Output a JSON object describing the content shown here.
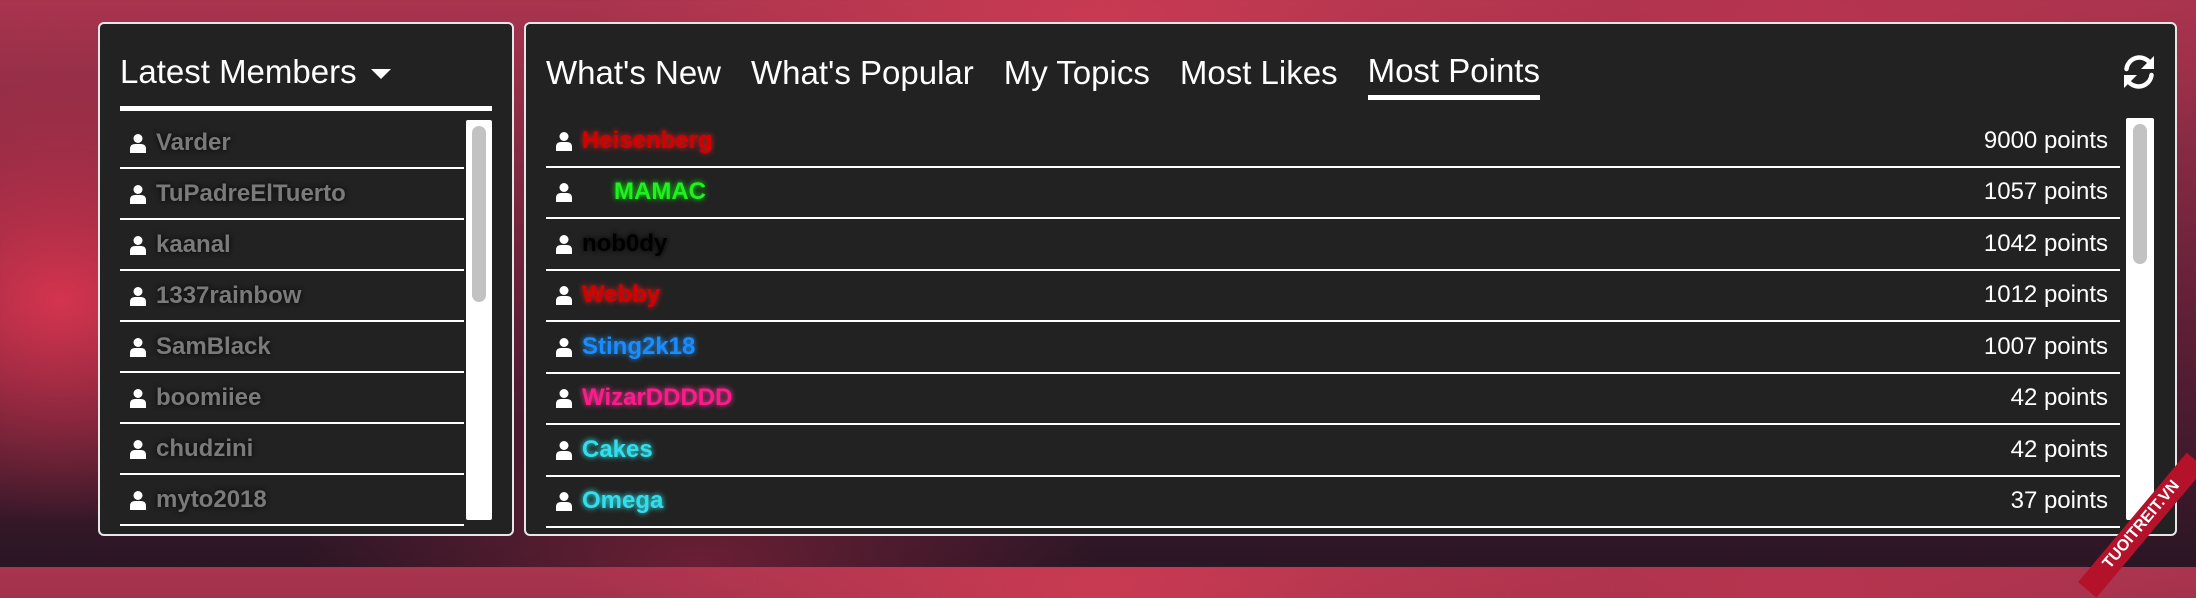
{
  "latest_members": {
    "title": "Latest Members",
    "members": [
      {
        "name": "Varder"
      },
      {
        "name": "TuPadreElTuerto"
      },
      {
        "name": "kaanal"
      },
      {
        "name": "1337rainbow"
      },
      {
        "name": "SamBlack"
      },
      {
        "name": "boomiiee"
      },
      {
        "name": "chudzini"
      },
      {
        "name": "myto2018"
      }
    ]
  },
  "tabs": [
    {
      "label": "What's New",
      "active": false
    },
    {
      "label": "What's Popular",
      "active": false
    },
    {
      "label": "My Topics",
      "active": false
    },
    {
      "label": "Most Likes",
      "active": false
    },
    {
      "label": "Most Points",
      "active": true
    }
  ],
  "refresh_icon": "refresh-icon",
  "most_points": [
    {
      "name": "Heisenberg",
      "points": "9000 points",
      "color": "#d40000",
      "glow": "#ff1a1a"
    },
    {
      "name": "MAMAC",
      "points": "1057 points",
      "color": "#22ee22",
      "glow": "#00ff00",
      "indent": true
    },
    {
      "name": "nob0dy",
      "points": "1042 points",
      "color": "#000000",
      "glow": "#000000"
    },
    {
      "name": "Webby",
      "points": "1012 points",
      "color": "#d40000",
      "glow": "#ff1a1a"
    },
    {
      "name": "Sting2k18",
      "points": "1007 points",
      "color": "#1a8cff",
      "glow": "#2299ff"
    },
    {
      "name": "WizarDDDDD",
      "points": "42 points",
      "color": "#ff1a8c",
      "glow": "#ff3399"
    },
    {
      "name": "Cakes",
      "points": "42 points",
      "color": "#33ddee",
      "glow": "#33ffff"
    },
    {
      "name": "Omega",
      "points": "37 points",
      "color": "#33ddee",
      "glow": "#33ffff"
    }
  ],
  "watermark": "TUOITREIT.VN"
}
